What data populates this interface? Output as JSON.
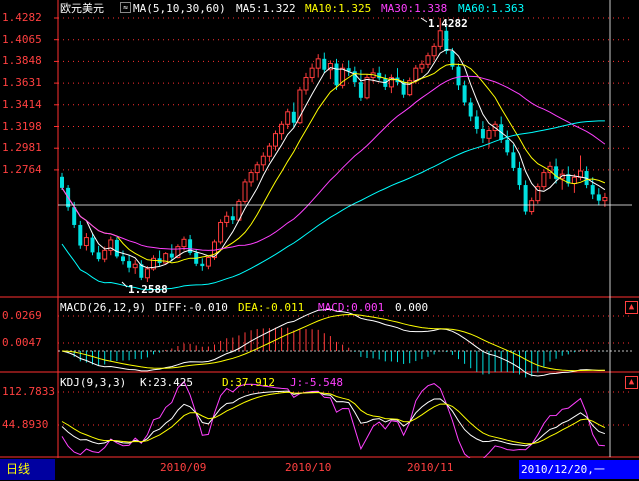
{
  "main_panel": {
    "symbol": "欧元美元",
    "ma_label": "MA(5,10,30,60)",
    "ma5": "MA5:1.322",
    "ma10": "MA10:1.325",
    "ma30": "MA30:1.338",
    "ma60": "MA60:1.363",
    "high_annotation": "1.4282",
    "low_annotation": "1.2588",
    "y_ticks": [
      "1.4282",
      "1.4065",
      "1.3848",
      "1.3631",
      "1.3414",
      "1.3198",
      "1.2981",
      "1.2764"
    ]
  },
  "macd_panel": {
    "label": "MACD(26,12,9)",
    "diff": "DIFF:-0.010",
    "dea": "DEA:-0.011",
    "macd": "MACD:0.001",
    "extra": "0.000",
    "y_ticks": [
      "0.0269",
      "0.0047"
    ]
  },
  "kdj_panel": {
    "label": "KDJ(9,3,3)",
    "k": "K:23.425",
    "d": "D:37.912",
    "j": "J:-5.548",
    "y_ticks": [
      "112.7833",
      "44.8930"
    ]
  },
  "x_axis": {
    "labels": [
      "2010/09",
      "2010/10",
      "2010/11"
    ]
  },
  "period_tab": "日线",
  "cursor_date": "2010/12/20,一",
  "expand_icon": "▲",
  "colors": {
    "up": "#ff3c3c",
    "down": "#00e0e0",
    "ma5": "#ffffff",
    "ma10": "#ffff00",
    "ma30": "#ff40ff",
    "ma60": "#00ff00",
    "frame": "#ff3030",
    "diff": "#ffffff",
    "dea": "#ffff00"
  },
  "chart_data": {
    "type": "candlestick",
    "ylim": [
      1.2588,
      1.4282
    ],
    "candles": [
      [
        1.3263,
        1.3288,
        1.3178,
        1.3192
      ],
      [
        1.3192,
        1.321,
        1.3045,
        1.3068
      ],
      [
        1.3068,
        1.3102,
        1.2935,
        1.2954
      ],
      [
        1.2954,
        1.298,
        1.2801,
        1.2822
      ],
      [
        1.2822,
        1.2902,
        1.279,
        1.2873
      ],
      [
        1.2873,
        1.2901,
        1.276,
        1.2778
      ],
      [
        1.2778,
        1.282,
        1.272,
        1.2735
      ],
      [
        1.2735,
        1.2815,
        1.2715,
        1.2791
      ],
      [
        1.2791,
        1.288,
        1.276,
        1.2858
      ],
      [
        1.2858,
        1.2875,
        1.274,
        1.2752
      ],
      [
        1.2752,
        1.279,
        1.27,
        1.2722
      ],
      [
        1.2722,
        1.276,
        1.265,
        1.268
      ],
      [
        1.268,
        1.273,
        1.264,
        1.2702
      ],
      [
        1.2702,
        1.2728,
        1.26,
        1.2615
      ],
      [
        1.2615,
        1.269,
        1.2588,
        1.2672
      ],
      [
        1.2672,
        1.276,
        1.266,
        1.274
      ],
      [
        1.274,
        1.279,
        1.269,
        1.271
      ],
      [
        1.271,
        1.278,
        1.27,
        1.277
      ],
      [
        1.277,
        1.283,
        1.272,
        1.2745
      ],
      [
        1.2745,
        1.283,
        1.274,
        1.2815
      ],
      [
        1.2815,
        1.288,
        1.279,
        1.2862
      ],
      [
        1.2862,
        1.289,
        1.276,
        1.2775
      ],
      [
        1.2775,
        1.28,
        1.269,
        1.2705
      ],
      [
        1.2705,
        1.274,
        1.266,
        1.269
      ],
      [
        1.269,
        1.276,
        1.267,
        1.2745
      ],
      [
        1.2745,
        1.286,
        1.273,
        1.2845
      ],
      [
        1.2845,
        1.299,
        1.283,
        1.297
      ],
      [
        1.297,
        1.304,
        1.294,
        1.301
      ],
      [
        1.301,
        1.307,
        1.296,
        1.2985
      ],
      [
        1.2985,
        1.312,
        1.298,
        1.3105
      ],
      [
        1.3105,
        1.325,
        1.309,
        1.323
      ],
      [
        1.323,
        1.331,
        1.32,
        1.329
      ],
      [
        1.329,
        1.336,
        1.324,
        1.334
      ],
      [
        1.334,
        1.342,
        1.33,
        1.3395
      ],
      [
        1.3395,
        1.348,
        1.336,
        1.346
      ],
      [
        1.346,
        1.356,
        1.343,
        1.354
      ],
      [
        1.354,
        1.362,
        1.35,
        1.36
      ],
      [
        1.36,
        1.37,
        1.357,
        1.368
      ],
      [
        1.368,
        1.374,
        1.358,
        1.361
      ],
      [
        1.361,
        1.384,
        1.36,
        1.382
      ],
      [
        1.382,
        1.393,
        1.379,
        1.39
      ],
      [
        1.39,
        1.399,
        1.387,
        1.396
      ],
      [
        1.396,
        1.405,
        1.39,
        1.402
      ],
      [
        1.402,
        1.406,
        1.393,
        1.395
      ],
      [
        1.395,
        1.401,
        1.389,
        1.399
      ],
      [
        1.399,
        1.402,
        1.382,
        1.385
      ],
      [
        1.385,
        1.399,
        1.383,
        1.396
      ],
      [
        1.396,
        1.401,
        1.391,
        1.394
      ],
      [
        1.394,
        1.397,
        1.384,
        1.387
      ],
      [
        1.387,
        1.395,
        1.375,
        1.377
      ],
      [
        1.377,
        1.392,
        1.376,
        1.39
      ],
      [
        1.39,
        1.396,
        1.387,
        1.393
      ],
      [
        1.393,
        1.397,
        1.388,
        1.3895
      ],
      [
        1.3895,
        1.392,
        1.382,
        1.384
      ],
      [
        1.384,
        1.392,
        1.38,
        1.39
      ],
      [
        1.39,
        1.396,
        1.385,
        1.387
      ],
      [
        1.387,
        1.389,
        1.377,
        1.379
      ],
      [
        1.379,
        1.39,
        1.378,
        1.388
      ],
      [
        1.388,
        1.398,
        1.386,
        1.396
      ],
      [
        1.396,
        1.401,
        1.393,
        1.3985
      ],
      [
        1.3985,
        1.406,
        1.396,
        1.404
      ],
      [
        1.404,
        1.412,
        1.401,
        1.41
      ],
      [
        1.41,
        1.4282,
        1.408,
        1.42
      ],
      [
        1.42,
        1.423,
        1.405,
        1.407
      ],
      [
        1.407,
        1.409,
        1.395,
        1.397
      ],
      [
        1.397,
        1.399,
        1.382,
        1.385
      ],
      [
        1.385,
        1.388,
        1.372,
        1.374
      ],
      [
        1.374,
        1.377,
        1.362,
        1.365
      ],
      [
        1.365,
        1.369,
        1.354,
        1.357
      ],
      [
        1.357,
        1.362,
        1.348,
        1.351
      ],
      [
        1.351,
        1.358,
        1.345,
        1.356
      ],
      [
        1.356,
        1.362,
        1.352,
        1.36
      ],
      [
        1.36,
        1.365,
        1.348,
        1.35
      ],
      [
        1.35,
        1.356,
        1.34,
        1.342
      ],
      [
        1.342,
        1.347,
        1.33,
        1.332
      ],
      [
        1.332,
        1.336,
        1.318,
        1.321
      ],
      [
        1.321,
        1.324,
        1.302,
        1.304
      ],
      [
        1.304,
        1.313,
        1.302,
        1.311
      ],
      [
        1.311,
        1.322,
        1.309,
        1.32
      ],
      [
        1.32,
        1.331,
        1.318,
        1.329
      ],
      [
        1.329,
        1.336,
        1.325,
        1.333
      ],
      [
        1.333,
        1.338,
        1.322,
        1.325
      ],
      [
        1.325,
        1.331,
        1.318,
        1.328
      ],
      [
        1.328,
        1.333,
        1.32,
        1.322
      ],
      [
        1.322,
        1.328,
        1.316,
        1.326
      ],
      [
        1.326,
        1.34,
        1.324,
        1.33
      ],
      [
        1.33,
        1.333,
        1.319,
        1.321
      ],
      [
        1.321,
        1.326,
        1.312,
        1.315
      ],
      [
        1.315,
        1.319,
        1.308,
        1.311
      ],
      [
        1.311,
        1.316,
        1.307,
        1.313
      ]
    ]
  }
}
